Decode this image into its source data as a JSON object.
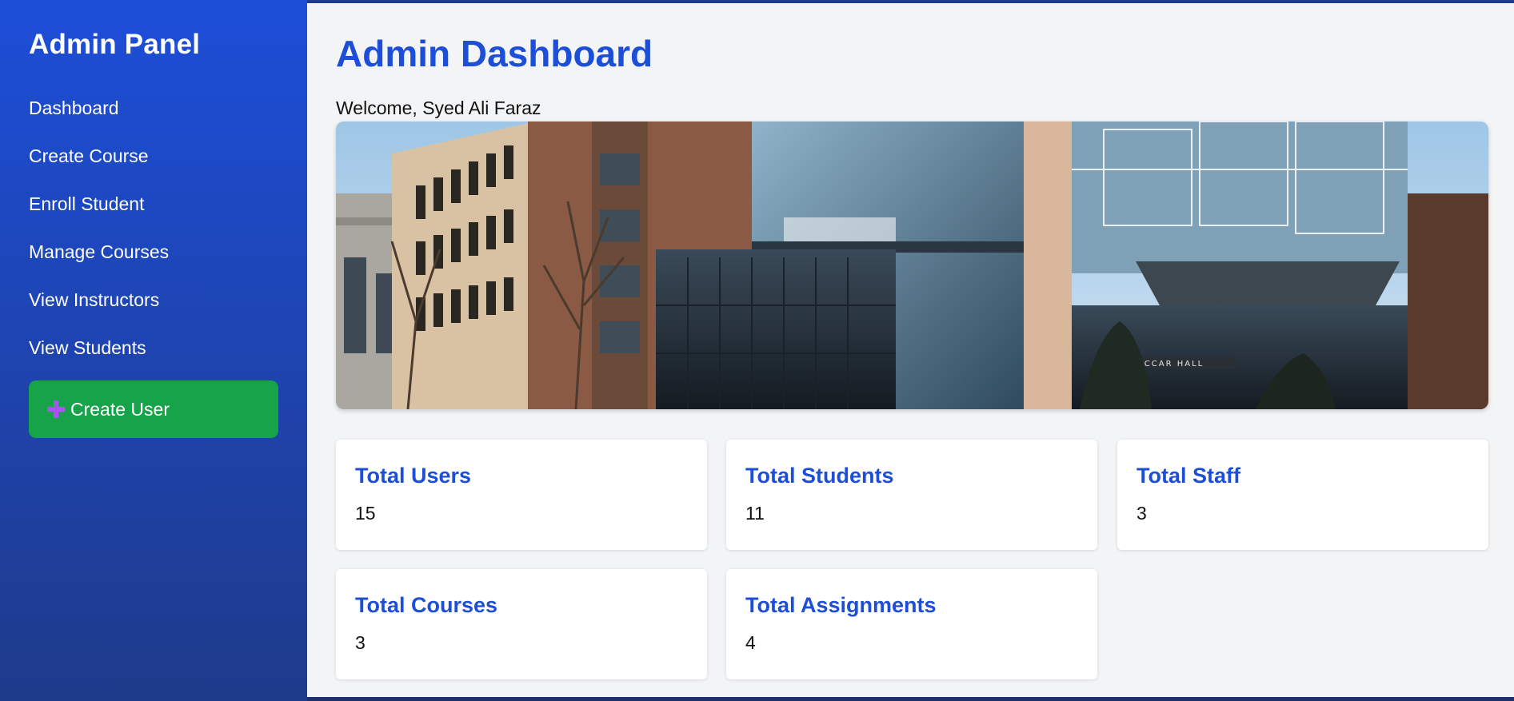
{
  "sidebar": {
    "title": "Admin Panel",
    "items": [
      {
        "label": "Dashboard"
      },
      {
        "label": "Create Course"
      },
      {
        "label": "Enroll Student"
      },
      {
        "label": "Manage Courses"
      },
      {
        "label": "View Instructors"
      },
      {
        "label": "View Students"
      }
    ],
    "create_user": {
      "label": "Create User",
      "icon": "plus-icon"
    }
  },
  "main": {
    "title": "Admin Dashboard",
    "welcome": "Welcome, Syed Ali Faraz",
    "hero_sign": "PACCAR HALL",
    "stats": [
      {
        "title": "Total Users",
        "value": "15"
      },
      {
        "title": "Total Students",
        "value": "11"
      },
      {
        "title": "Total Staff",
        "value": "3"
      },
      {
        "title": "Total Courses",
        "value": "3"
      },
      {
        "title": "Total Assignments",
        "value": "4"
      }
    ]
  },
  "colors": {
    "sidebar_top": "#1d4ed8",
    "sidebar_bottom": "#1e3a8a",
    "accent": "#1d4ed8",
    "button_green": "#16a34a",
    "main_bg": "#f3f4f6"
  }
}
